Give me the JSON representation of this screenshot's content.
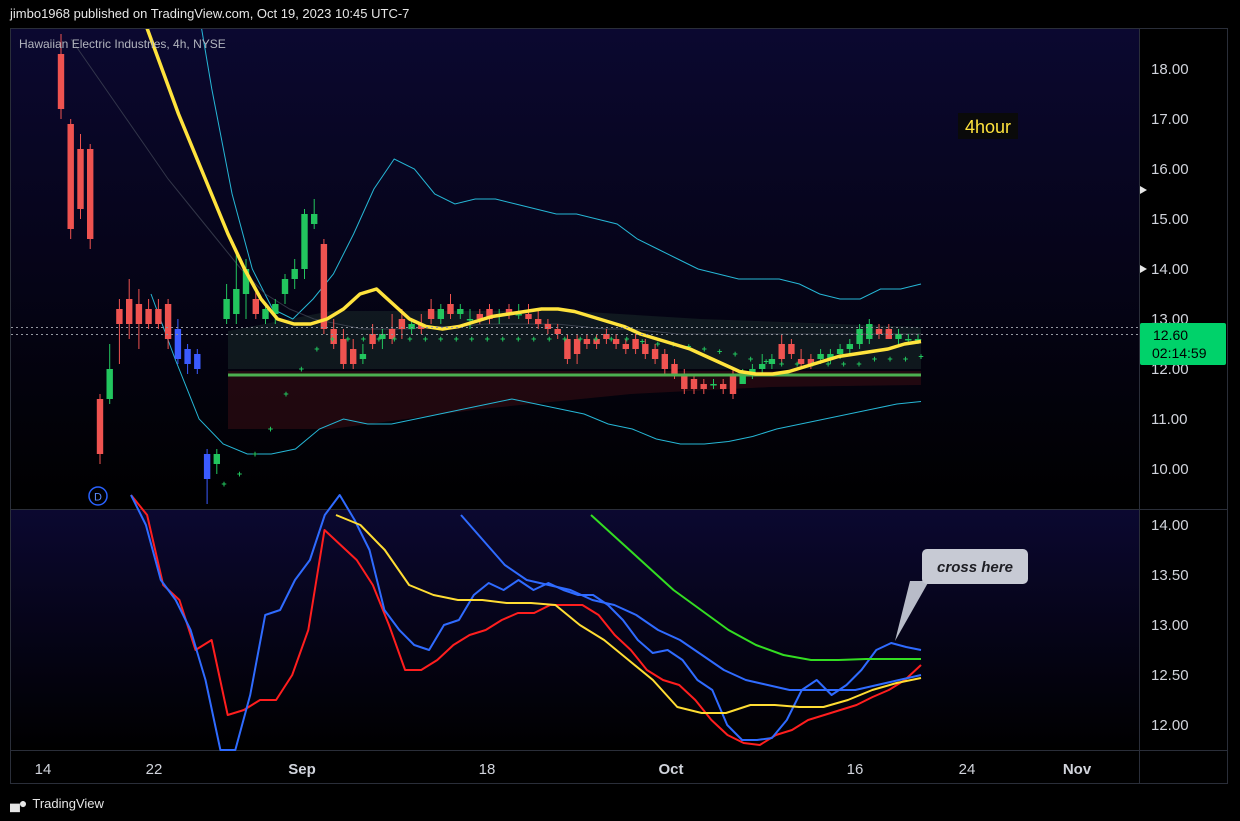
{
  "header": {
    "published_by": "jimbo1968 published on TradingView.com, Oct 19, 2023 10:45 UTC-7"
  },
  "symbol": {
    "title": "Hawaiian Electric Industries, 4h, NYSE"
  },
  "annotations": {
    "timeframe_label": "4hour",
    "callout": "cross here",
    "dividend_marker": "D"
  },
  "price_badge": {
    "price": "12.60",
    "countdown": "02:14:59"
  },
  "footer": {
    "brand": "TradingView"
  },
  "colors": {
    "background_top": "#0b0830",
    "background_bottom": "#000000",
    "up_candle": "#22c55e",
    "down_candle": "#ef5350",
    "down_candle_blue": "#3b5bff",
    "yellow_ma": "#ffe33d",
    "cyan_band": "#26b7d6",
    "support_line": "#4caf50",
    "osc_red": "#ff1e1e",
    "osc_blue": "#2f6bff",
    "osc_yellow": "#ffdd33",
    "osc_green": "#33dd22",
    "badge_green": "#00d26a"
  },
  "chart_data": [
    {
      "type": "candlestick",
      "title": "Hawaiian Electric Industries, 4h, NYSE",
      "y_ticks": [
        "18.00",
        "17.00",
        "16.00",
        "15.00",
        "14.00",
        "13.00",
        "12.00",
        "11.00",
        "10.00"
      ],
      "ylim": [
        9.2,
        18.8
      ],
      "x_ticks": [
        "14",
        "22",
        "Sep",
        "18",
        "Oct",
        "16",
        "24",
        "Nov"
      ],
      "current_price": 12.6,
      "support_level": 11.88,
      "candles": [
        {
          "o": 18.3,
          "h": 18.7,
          "l": 17.0,
          "c": 17.2
        },
        {
          "o": 16.9,
          "h": 17.0,
          "l": 14.6,
          "c": 14.8
        },
        {
          "o": 16.4,
          "h": 16.7,
          "l": 15.0,
          "c": 15.2
        },
        {
          "o": 16.4,
          "h": 16.5,
          "l": 14.4,
          "c": 14.6
        },
        {
          "o": 11.4,
          "h": 11.5,
          "l": 10.1,
          "c": 10.3
        },
        {
          "o": 11.4,
          "h": 12.5,
          "l": 11.3,
          "c": 12.0
        },
        {
          "o": 13.2,
          "h": 13.4,
          "l": 12.1,
          "c": 12.9
        },
        {
          "o": 13.4,
          "h": 13.8,
          "l": 12.6,
          "c": 12.9
        },
        {
          "o": 13.3,
          "h": 13.6,
          "l": 12.4,
          "c": 12.9
        },
        {
          "o": 13.2,
          "h": 13.4,
          "l": 12.8,
          "c": 12.9
        },
        {
          "o": 13.2,
          "h": 13.4,
          "l": 12.8,
          "c": 12.9
        },
        {
          "o": 13.3,
          "h": 13.4,
          "l": 12.4,
          "c": 12.6
        },
        {
          "o": 12.8,
          "h": 13.0,
          "l": 12.1,
          "c": 12.2
        },
        {
          "o": 12.4,
          "h": 12.5,
          "l": 11.9,
          "c": 12.1
        },
        {
          "o": 12.3,
          "h": 12.4,
          "l": 11.9,
          "c": 12.0
        },
        {
          "o": 10.3,
          "h": 10.4,
          "l": 9.3,
          "c": 9.8
        },
        {
          "o": 10.1,
          "h": 10.4,
          "l": 9.9,
          "c": 10.3
        },
        {
          "o": 13.0,
          "h": 13.7,
          "l": 12.9,
          "c": 13.4
        },
        {
          "o": 13.1,
          "h": 14.4,
          "l": 12.9,
          "c": 13.6
        },
        {
          "o": 13.5,
          "h": 14.2,
          "l": 13.0,
          "c": 14.0
        },
        {
          "o": 13.4,
          "h": 13.6,
          "l": 13.0,
          "c": 13.1
        },
        {
          "o": 13.0,
          "h": 13.3,
          "l": 12.9,
          "c": 13.2
        },
        {
          "o": 13.1,
          "h": 13.4,
          "l": 12.9,
          "c": 13.3
        },
        {
          "o": 13.5,
          "h": 13.9,
          "l": 13.3,
          "c": 13.8
        },
        {
          "o": 13.8,
          "h": 14.2,
          "l": 13.6,
          "c": 14.0
        },
        {
          "o": 14.0,
          "h": 15.2,
          "l": 13.8,
          "c": 15.1
        },
        {
          "o": 14.9,
          "h": 15.4,
          "l": 14.8,
          "c": 15.1
        },
        {
          "o": 14.5,
          "h": 14.6,
          "l": 12.7,
          "c": 12.8
        },
        {
          "o": 12.8,
          "h": 13.0,
          "l": 12.4,
          "c": 12.5
        },
        {
          "o": 12.6,
          "h": 12.8,
          "l": 12.0,
          "c": 12.1
        },
        {
          "o": 12.4,
          "h": 12.6,
          "l": 12.0,
          "c": 12.1
        },
        {
          "o": 12.2,
          "h": 12.5,
          "l": 12.1,
          "c": 12.3
        },
        {
          "o": 12.7,
          "h": 12.9,
          "l": 12.4,
          "c": 12.5
        },
        {
          "o": 12.6,
          "h": 12.8,
          "l": 12.4,
          "c": 12.7
        },
        {
          "o": 12.8,
          "h": 13.1,
          "l": 12.5,
          "c": 12.6
        },
        {
          "o": 13.0,
          "h": 13.2,
          "l": 12.6,
          "c": 12.8
        },
        {
          "o": 12.8,
          "h": 13.0,
          "l": 12.7,
          "c": 12.9
        },
        {
          "o": 12.9,
          "h": 13.1,
          "l": 12.7,
          "c": 12.8
        },
        {
          "o": 13.2,
          "h": 13.4,
          "l": 12.9,
          "c": 13.0
        },
        {
          "o": 13.0,
          "h": 13.3,
          "l": 12.9,
          "c": 13.2
        },
        {
          "o": 13.3,
          "h": 13.5,
          "l": 13.0,
          "c": 13.1
        },
        {
          "o": 13.1,
          "h": 13.3,
          "l": 13.0,
          "c": 13.2
        },
        {
          "o": 13.0,
          "h": 13.2,
          "l": 12.8,
          "c": 13.0
        },
        {
          "o": 13.1,
          "h": 13.2,
          "l": 12.9,
          "c": 13.0
        },
        {
          "o": 13.2,
          "h": 13.3,
          "l": 12.9,
          "c": 13.0
        },
        {
          "o": 13.1,
          "h": 13.2,
          "l": 12.9,
          "c": 13.1
        },
        {
          "o": 13.2,
          "h": 13.3,
          "l": 13.0,
          "c": 13.1
        },
        {
          "o": 13.1,
          "h": 13.3,
          "l": 13.0,
          "c": 13.1
        },
        {
          "o": 13.1,
          "h": 13.3,
          "l": 12.9,
          "c": 13.0
        },
        {
          "o": 13.0,
          "h": 13.2,
          "l": 12.8,
          "c": 12.9
        },
        {
          "o": 12.9,
          "h": 13.0,
          "l": 12.7,
          "c": 12.8
        },
        {
          "o": 12.8,
          "h": 12.9,
          "l": 12.6,
          "c": 12.7
        },
        {
          "o": 12.6,
          "h": 12.7,
          "l": 12.1,
          "c": 12.2
        },
        {
          "o": 12.6,
          "h": 12.7,
          "l": 12.1,
          "c": 12.3
        },
        {
          "o": 12.6,
          "h": 12.7,
          "l": 12.4,
          "c": 12.5
        },
        {
          "o": 12.6,
          "h": 12.7,
          "l": 12.4,
          "c": 12.5
        },
        {
          "o": 12.7,
          "h": 12.8,
          "l": 12.5,
          "c": 12.6
        },
        {
          "o": 12.6,
          "h": 12.7,
          "l": 12.4,
          "c": 12.5
        },
        {
          "o": 12.5,
          "h": 12.6,
          "l": 12.3,
          "c": 12.4
        },
        {
          "o": 12.6,
          "h": 12.7,
          "l": 12.3,
          "c": 12.4
        },
        {
          "o": 12.5,
          "h": 12.6,
          "l": 12.2,
          "c": 12.3
        },
        {
          "o": 12.4,
          "h": 12.5,
          "l": 12.1,
          "c": 12.2
        },
        {
          "o": 12.3,
          "h": 12.4,
          "l": 11.9,
          "c": 12.0
        },
        {
          "o": 12.1,
          "h": 12.2,
          "l": 11.8,
          "c": 11.9
        },
        {
          "o": 11.9,
          "h": 12.0,
          "l": 11.5,
          "c": 11.6
        },
        {
          "o": 11.8,
          "h": 11.9,
          "l": 11.5,
          "c": 11.6
        },
        {
          "o": 11.7,
          "h": 11.8,
          "l": 11.5,
          "c": 11.6
        },
        {
          "o": 11.7,
          "h": 11.8,
          "l": 11.6,
          "c": 11.7
        },
        {
          "o": 11.7,
          "h": 11.8,
          "l": 11.5,
          "c": 11.6
        },
        {
          "o": 11.9,
          "h": 12.0,
          "l": 11.4,
          "c": 11.5
        },
        {
          "o": 11.7,
          "h": 12.0,
          "l": 11.7,
          "c": 11.9
        },
        {
          "o": 11.9,
          "h": 12.1,
          "l": 11.8,
          "c": 12.0
        },
        {
          "o": 12.0,
          "h": 12.3,
          "l": 11.9,
          "c": 12.1
        },
        {
          "o": 12.1,
          "h": 12.3,
          "l": 12.0,
          "c": 12.2
        },
        {
          "o": 12.5,
          "h": 12.7,
          "l": 12.1,
          "c": 12.2
        },
        {
          "o": 12.5,
          "h": 12.6,
          "l": 12.2,
          "c": 12.3
        },
        {
          "o": 12.2,
          "h": 12.4,
          "l": 12.0,
          "c": 12.1
        },
        {
          "o": 12.2,
          "h": 12.3,
          "l": 12.0,
          "c": 12.1
        },
        {
          "o": 12.2,
          "h": 12.4,
          "l": 12.1,
          "c": 12.3
        },
        {
          "o": 12.2,
          "h": 12.4,
          "l": 12.1,
          "c": 12.3
        },
        {
          "o": 12.3,
          "h": 12.5,
          "l": 12.2,
          "c": 12.4
        },
        {
          "o": 12.4,
          "h": 12.6,
          "l": 12.3,
          "c": 12.5
        },
        {
          "o": 12.5,
          "h": 12.9,
          "l": 12.4,
          "c": 12.8
        },
        {
          "o": 12.6,
          "h": 13.0,
          "l": 12.5,
          "c": 12.9
        },
        {
          "o": 12.8,
          "h": 12.9,
          "l": 12.6,
          "c": 12.7
        },
        {
          "o": 12.8,
          "h": 12.9,
          "l": 12.6,
          "c": 12.6
        },
        {
          "o": 12.6,
          "h": 12.8,
          "l": 12.5,
          "c": 12.7
        },
        {
          "o": 12.6,
          "h": 12.7,
          "l": 12.5,
          "c": 12.6
        },
        {
          "o": 12.6,
          "h": 12.7,
          "l": 12.5,
          "c": 12.6
        }
      ],
      "series": [
        {
          "values": [
            19.6,
            18.9,
            18.0,
            17.1,
            16.3,
            15.5,
            14.7,
            14.0,
            13.4,
            13.0,
            12.9,
            12.9,
            13.0,
            13.2,
            13.5,
            13.6,
            13.3,
            13.0,
            12.85,
            12.8,
            12.85,
            12.95,
            13.05,
            13.1,
            13.15,
            13.2,
            13.2,
            13.15,
            13.05,
            12.95,
            12.85,
            12.7,
            12.6,
            12.5,
            12.4,
            12.25,
            12.1,
            11.95,
            11.9,
            11.9,
            11.95,
            12.05,
            12.15,
            12.25,
            12.3,
            12.35,
            12.4,
            12.5,
            12.55
          ]
        },
        {
          "values": [
            25.0,
            22.5,
            20.0,
            17.6,
            15.5,
            14.0,
            13.2,
            13.0,
            13.4,
            13.9,
            14.7,
            15.6,
            16.2,
            16.0,
            15.5,
            15.3,
            15.4,
            15.4,
            15.3,
            15.2,
            15.1,
            15.1,
            15.0,
            14.9,
            14.6,
            14.4,
            14.2,
            14.0,
            13.9,
            13.8,
            13.8,
            13.8,
            13.7,
            13.5,
            13.4,
            13.4,
            13.6,
            13.6,
            13.7
          ]
        },
        {
          "values": [
            13.5,
            12.2,
            11.0,
            10.5,
            10.3,
            10.3,
            10.4,
            10.8,
            11.0,
            10.9,
            10.9,
            11.0,
            11.1,
            11.2,
            11.3,
            11.4,
            11.3,
            11.2,
            11.1,
            10.9,
            10.8,
            10.6,
            10.5,
            10.5,
            10.55,
            10.65,
            10.8,
            10.9,
            11.0,
            11.1,
            11.2,
            11.3,
            11.35
          ]
        },
        {
          "values": [
            9.7,
            9.9,
            10.3,
            10.8,
            11.5,
            12.0,
            12.4,
            12.6,
            12.6,
            12.6,
            12.6,
            12.6,
            12.6,
            12.6,
            12.6,
            12.6,
            12.6,
            12.6,
            12.6,
            12.6,
            12.6,
            12.6,
            12.6,
            12.6,
            12.6,
            12.6,
            12.6,
            12.55,
            12.5,
            12.5,
            12.45,
            12.4,
            12.35,
            12.3,
            12.2,
            12.15,
            12.1,
            12.1,
            12.1,
            12.1,
            12.1,
            12.1,
            12.2,
            12.2,
            12.2,
            12.25
          ]
        },
        {
          "values": [
            18.6,
            17.9,
            17.2,
            16.5,
            15.8,
            15.2,
            14.6,
            14.0,
            13.5,
            13.2,
            13.0,
            12.9,
            12.8,
            12.8,
            12.8,
            12.85,
            12.85,
            12.9,
            12.9,
            12.9,
            12.9,
            12.85,
            12.8,
            12.8,
            12.75,
            12.7,
            12.7,
            12.7,
            12.7,
            12.7,
            12.7,
            12.7,
            12.7,
            12.7,
            12.7,
            12.7
          ]
        }
      ]
    },
    {
      "type": "line",
      "y_ticks": [
        "14.00",
        "13.50",
        "13.00",
        "12.50",
        "12.00"
      ],
      "ylim": [
        11.75,
        14.15
      ],
      "series": [
        {
          "values": [
            14.3,
            14.1,
            13.4,
            13.25,
            12.75,
            12.85,
            12.1,
            12.15,
            12.25,
            12.25,
            12.5,
            12.95,
            13.95,
            13.8,
            13.65,
            13.4,
            13.0,
            12.55,
            12.55,
            12.65,
            12.8,
            12.9,
            12.95,
            13.05,
            13.12,
            13.12,
            13.2,
            13.2,
            13.2,
            13.1,
            12.9,
            12.75,
            12.55,
            12.45,
            12.4,
            12.25,
            12.05,
            11.9,
            11.82,
            11.8,
            11.9,
            11.95,
            12.05,
            12.1,
            12.15,
            12.2,
            12.28,
            12.35,
            12.45,
            12.6
          ]
        },
        {
          "values": [
            14.3,
            14.0,
            13.45,
            13.25,
            12.95,
            12.45,
            11.75,
            11.75,
            12.3,
            13.1,
            13.15,
            13.45,
            13.65,
            14.1,
            14.3,
            14.05,
            13.75,
            13.15,
            12.95,
            12.8,
            12.75,
            13.0,
            13.05,
            13.3,
            13.42,
            13.35,
            13.45,
            13.35,
            13.42,
            13.35,
            13.3,
            13.3,
            13.2,
            13.05,
            12.85,
            12.72,
            12.75,
            12.65,
            12.45,
            12.35,
            12.0,
            11.85,
            11.85,
            11.87,
            12.05,
            12.35,
            12.45,
            12.3,
            12.4,
            12.55,
            12.75,
            12.82,
            12.78,
            12.75
          ]
        },
        {
          "values": [
            14.1,
            14.0,
            13.75,
            13.4,
            13.3,
            13.25,
            13.25,
            13.22,
            13.22,
            13.2,
            13.0,
            12.85,
            12.65,
            12.45,
            12.18,
            12.12,
            12.12,
            12.2,
            12.2,
            12.18,
            12.18,
            12.25,
            12.35,
            12.42,
            12.47
          ]
        },
        {
          "values": [
            14.1,
            13.85,
            13.6,
            13.45,
            13.4,
            13.35,
            13.25,
            13.2,
            13.1,
            12.95,
            12.85,
            12.7,
            12.55,
            12.45,
            12.4,
            12.35,
            12.35,
            12.35,
            12.35,
            12.4,
            12.45,
            12.5
          ]
        },
        {
          "values": [
            14.1,
            13.85,
            13.6,
            13.35,
            13.15,
            12.95,
            12.8,
            12.7,
            12.65,
            12.65,
            12.66,
            12.66,
            12.66
          ]
        }
      ]
    }
  ]
}
